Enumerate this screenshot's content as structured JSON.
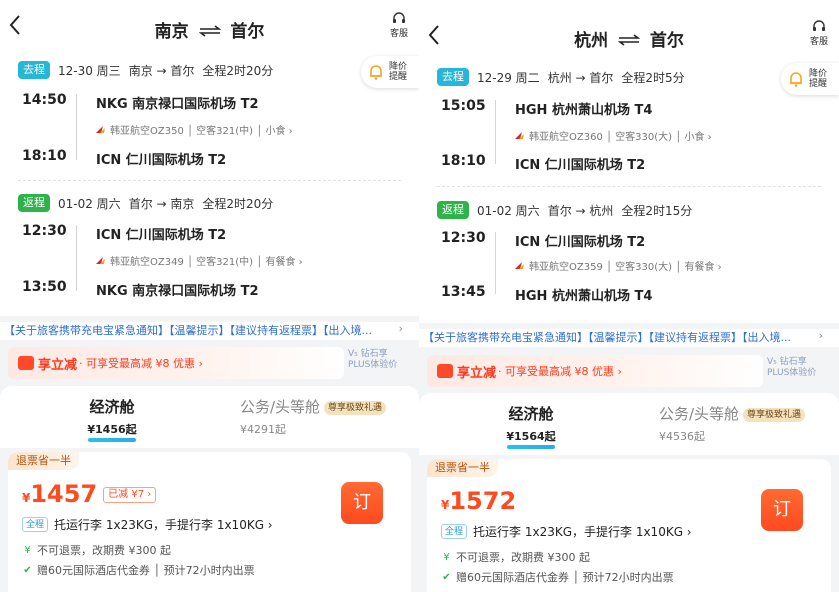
{
  "panels": [
    {
      "header": {
        "origin": "南京",
        "arrows": "⇄",
        "dest": "首尔",
        "service": "客服"
      },
      "remind": "降价提醒",
      "outbound": {
        "badge": "去程",
        "date": "12-30 周三",
        "route": "南京 → 首尔",
        "duration": "全程2时20分",
        "dep_time": "14:50",
        "dep_airport": "NKG 南京禄口国际机场 T2",
        "airline": "韩亚航空OZ350 │ 空客321(中) │ 小食 ›",
        "arr_time": "18:10",
        "arr_airport": "ICN 仁川国际机场 T2"
      },
      "inbound": {
        "badge": "返程",
        "date": "01-02 周六",
        "route": "首尔 → 南京",
        "duration": "全程2时20分",
        "dep_time": "12:30",
        "dep_airport": "ICN 仁川国际机场 T2",
        "airline": "韩亚航空OZ349 │ 空客321(中) │ 有餐食 ›",
        "arr_time": "13:50",
        "arr_airport": "NKG 南京禄口国际机场 T2"
      },
      "notice": "【关于旅客携带充电宝紧急通知】【温馨提示】【建议持有返程票】【出入境...",
      "promo": {
        "title": "享立减",
        "sub": "· 可享受最高减 ¥8 优惠 ›",
        "plus": "V₅ 钻石享\nPLUS体验价"
      },
      "tabs": {
        "economy": "经济舱",
        "economy_price": "¥1456起",
        "business": "公务/头等舱",
        "business_tag": "尊享极致礼遇",
        "business_price": "¥4291起"
      },
      "fare": {
        "refund_tag": "退票省一半",
        "yen": "¥",
        "price": "1457",
        "discount": "已减 ¥7 ›",
        "book": "订",
        "baggage_tag": "全程",
        "baggage": "托运行李 1x23KG，手提行李 1x10KG ›",
        "rule1": "不可退票，改期费 ¥300 起",
        "rule2": "赠60元国际酒店代金券 │ 预计72小时内出票"
      }
    },
    {
      "header": {
        "origin": "杭州",
        "arrows": "⇄",
        "dest": "首尔",
        "service": "客服"
      },
      "remind": "降价提醒",
      "outbound": {
        "badge": "去程",
        "date": "12-29 周二",
        "route": "杭州 → 首尔",
        "duration": "全程2时5分",
        "dep_time": "15:05",
        "dep_airport": "HGH 杭州萧山机场 T4",
        "airline": "韩亚航空OZ360 │ 空客330(大) │ 小食 ›",
        "arr_time": "18:10",
        "arr_airport": "ICN 仁川国际机场 T2"
      },
      "inbound": {
        "badge": "返程",
        "date": "01-02 周六",
        "route": "首尔 → 杭州",
        "duration": "全程2时15分",
        "dep_time": "12:30",
        "dep_airport": "ICN 仁川国际机场 T2",
        "airline": "韩亚航空OZ359 │ 空客330(大) │ 有餐食 ›",
        "arr_time": "13:45",
        "arr_airport": "HGH 杭州萧山机场 T4"
      },
      "notice": "【关于旅客携带充电宝紧急通知】【温馨提示】【建议持有返程票】【出入境...",
      "promo": {
        "title": "享立减",
        "sub": "· 可享受最高减 ¥8 优惠 ›",
        "plus": "V₅ 钻石享\nPLUS体验价"
      },
      "tabs": {
        "economy": "经济舱",
        "economy_price": "¥1564起",
        "business": "公务/头等舱",
        "business_tag": "尊享极致礼遇",
        "business_price": "¥4536起"
      },
      "fare": {
        "refund_tag": "退票省一半",
        "yen": "¥",
        "price": "1572",
        "discount": "",
        "book": "订",
        "baggage_tag": "全程",
        "baggage": "托运行李 1x23KG，手提行李 1x10KG ›",
        "rule1": "不可退票，改期费 ¥300 起",
        "rule2": "赠60元国际酒店代金券 │ 预计72小时内出票"
      }
    }
  ],
  "colors": {
    "accent": "#ff4a1f",
    "outbound_badge": "#26b6d6",
    "return_badge": "#2db34a",
    "notice": "#2f6fd0"
  }
}
